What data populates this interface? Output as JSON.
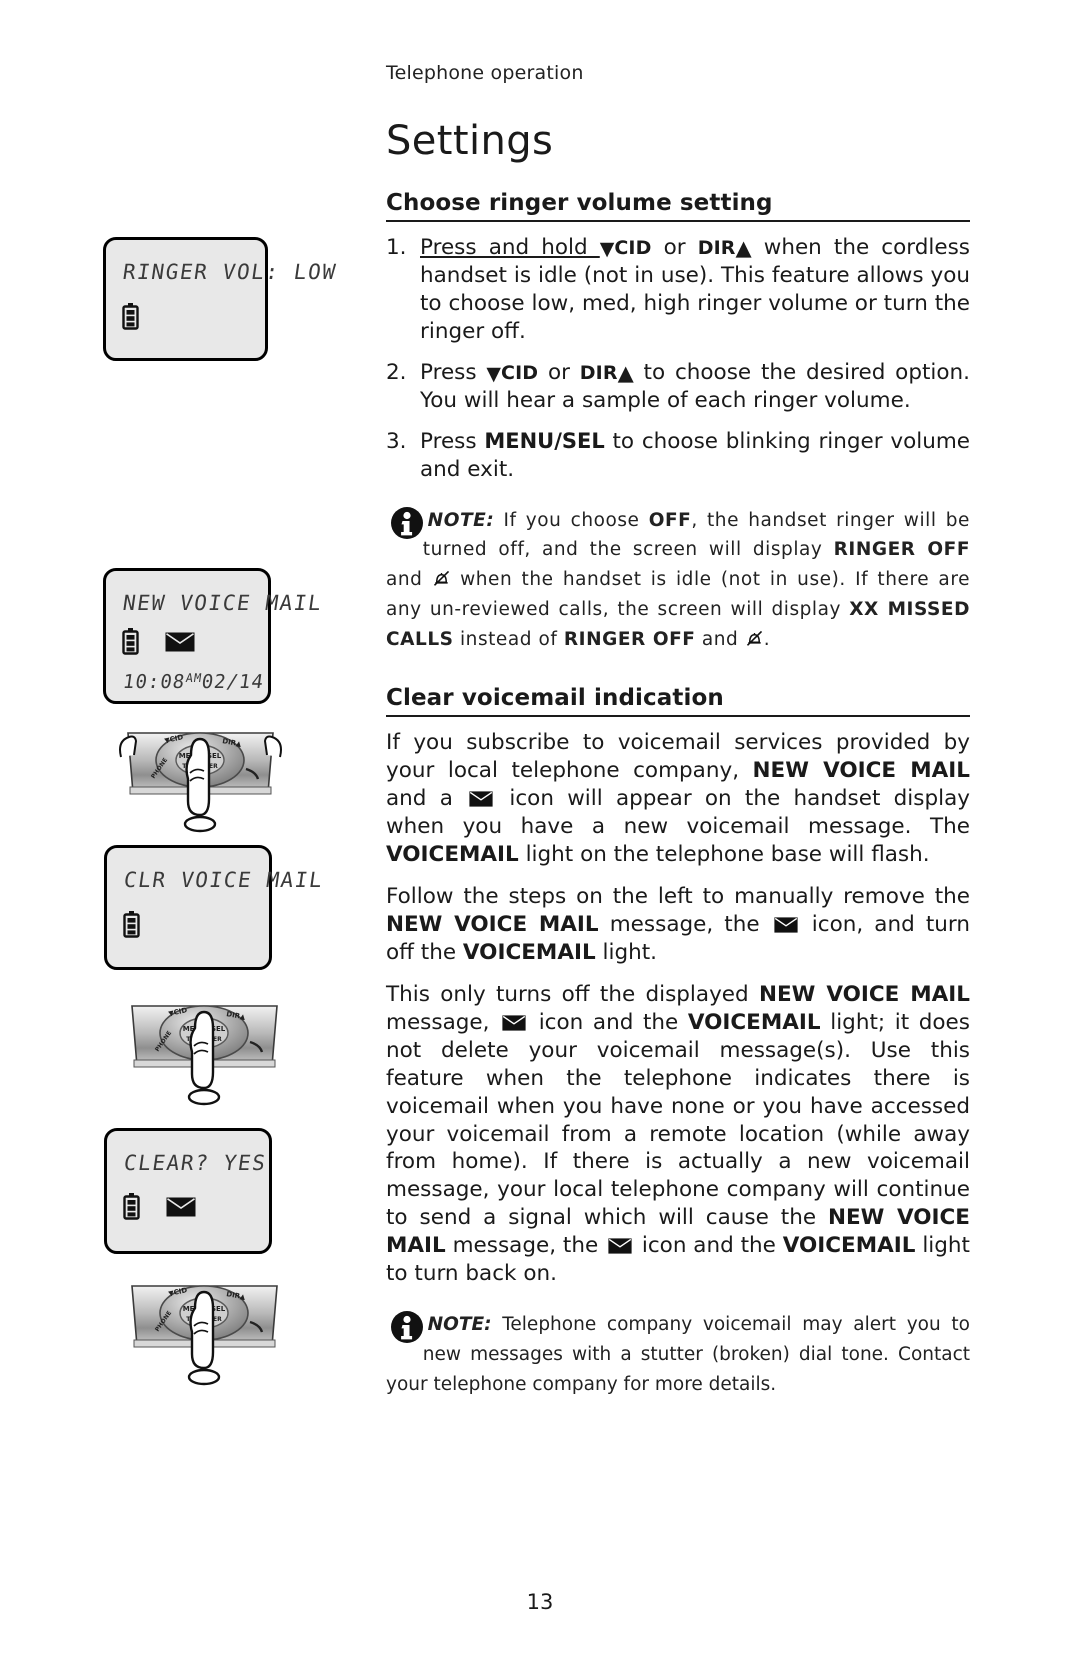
{
  "running_head": "Telephone operation",
  "page_title": "Settings",
  "folio": "13",
  "sections": [
    {
      "id": "ringer-volume",
      "heading": "Choose ringer volume setting",
      "steps": [
        {
          "num": "1.",
          "parts": [
            {
              "t": "Press and hold ",
              "style": "underline"
            },
            {
              "t": "▼",
              "style": "triangle"
            },
            {
              "t": "CID",
              "style": "key"
            },
            {
              "t": " or ",
              "style": "plain"
            },
            {
              "t": "DIR",
              "style": "key"
            },
            {
              "t": " ▲",
              "style": "triangle"
            },
            {
              "t": " when the cordless handset is idle (not in use). This feature allows you to choose low, med, high ringer volume or turn the ringer off.",
              "style": "plain"
            }
          ]
        },
        {
          "num": "2.",
          "parts": [
            {
              "t": "Press ",
              "style": "plain"
            },
            {
              "t": "▼",
              "style": "triangle"
            },
            {
              "t": "CID",
              "style": "key"
            },
            {
              "t": " or ",
              "style": "plain"
            },
            {
              "t": "DIR",
              "style": "key"
            },
            {
              "t": " ▲",
              "style": "triangle"
            },
            {
              "t": " to choose the desired option. You will hear a sample of each ringer volume.",
              "style": "plain"
            }
          ]
        },
        {
          "num": "3.",
          "parts": [
            {
              "t": "Press ",
              "style": "plain"
            },
            {
              "t": "MENU/SEL",
              "style": "key-lg"
            },
            {
              "t": " to choose blinking ringer volume and exit.",
              "style": "plain"
            }
          ]
        }
      ],
      "note": {
        "lead": "NOTE:",
        "parts": [
          {
            "t": " If you choose ",
            "style": "plain"
          },
          {
            "t": "OFF",
            "style": "bold"
          },
          {
            "t": ", the handset ringer will be turned off, and the screen will display ",
            "style": "plain"
          },
          {
            "t": "RINGER OFF",
            "style": "bold"
          },
          {
            "t": " and ",
            "style": "plain"
          },
          {
            "t": "bell-off-icon",
            "style": "icon-bell-off"
          },
          {
            "t": " when the handset is idle (not in use). If there are any un-reviewed calls, the screen will display ",
            "style": "plain"
          },
          {
            "t": "XX MISSED CALLS",
            "style": "bold"
          },
          {
            "t": " instead of ",
            "style": "plain"
          },
          {
            "t": "RINGER OFF",
            "style": "bold"
          },
          {
            "t": " and ",
            "style": "plain"
          },
          {
            "t": "bell-off-icon",
            "style": "icon-bell-off"
          },
          {
            "t": ".",
            "style": "plain"
          }
        ]
      }
    },
    {
      "id": "clear-voicemail",
      "heading": "Clear voicemail indication",
      "paragraphs": [
        [
          {
            "t": "If you subscribe to voicemail services provided by your local telephone company, ",
            "style": "plain"
          },
          {
            "t": "NEW VOICE MAIL",
            "style": "bold"
          },
          {
            "t": " and a ",
            "style": "plain"
          },
          {
            "t": "envelope-icon",
            "style": "icon-envelope"
          },
          {
            "t": " icon will appear on the handset display when you have a new voicemail message. The ",
            "style": "plain"
          },
          {
            "t": "VOICEMAIL",
            "style": "bold"
          },
          {
            "t": " light on the telephone base will flash.",
            "style": "plain"
          }
        ],
        [
          {
            "t": "Follow the steps on the left to manually remove the ",
            "style": "plain"
          },
          {
            "t": "NEW VOICE MAIL",
            "style": "bold"
          },
          {
            "t": " message, the ",
            "style": "plain"
          },
          {
            "t": "envelope-icon",
            "style": "icon-envelope"
          },
          {
            "t": " icon, and turn off the ",
            "style": "plain"
          },
          {
            "t": "VOICEMAIL",
            "style": "bold"
          },
          {
            "t": " light.",
            "style": "plain"
          }
        ],
        [
          {
            "t": "This only turns off the displayed ",
            "style": "plain"
          },
          {
            "t": "NEW VOICE MAIL",
            "style": "bold"
          },
          {
            "t": " message, ",
            "style": "plain"
          },
          {
            "t": "envelope-icon",
            "style": "icon-envelope"
          },
          {
            "t": " icon and the ",
            "style": "plain"
          },
          {
            "t": "VOICEMAIL",
            "style": "bold"
          },
          {
            "t": " light; it does not delete your voicemail message(s). Use this feature when the telephone indicates there is voicemail when you have none or you have accessed your voicemail from a remote location (while away from home). If there is actually a new voicemail message, your local telephone company will continue to send a signal which will cause the ",
            "style": "plain"
          },
          {
            "t": "NEW VOICE MAIL",
            "style": "bold"
          },
          {
            "t": " message, the ",
            "style": "plain"
          },
          {
            "t": "envelope-icon",
            "style": "icon-envelope"
          },
          {
            "t": " icon and the ",
            "style": "plain"
          },
          {
            "t": "VOICEMAIL",
            "style": "bold"
          },
          {
            "t": " light to turn back on.",
            "style": "plain"
          }
        ]
      ],
      "note": {
        "lead": "NOTE:",
        "parts": [
          {
            "t": " Telephone company voicemail may alert you to new messages with a stutter (broken) dial tone. Contact your telephone company for more details.",
            "style": "plain"
          }
        ]
      }
    }
  ],
  "illustrations": {
    "lcd_screens": [
      {
        "id": "lcd-ringer-vol",
        "text": "RINGER VOL: LOW",
        "icons": [
          "battery-icon"
        ],
        "time": null,
        "date": null
      },
      {
        "id": "lcd-new-voice-mail",
        "text": "NEW VOICE MAIL",
        "icons": [
          "battery-icon",
          "envelope-icon"
        ],
        "time": "10:08",
        "ampm": "AM",
        "date": "02/14"
      },
      {
        "id": "lcd-clr-voice-mail",
        "text": "CLR VOICE MAIL",
        "icons": [
          "battery-icon"
        ],
        "time": null,
        "date": null
      },
      {
        "id": "lcd-clear-yes",
        "text": "CLEAR? YES",
        "icons": [
          "battery-icon",
          "envelope-icon"
        ],
        "time": null,
        "date": null
      }
    ],
    "handset_presses": [
      {
        "id": "handset-press-1",
        "keys": [
          "CID",
          "DIR",
          "MENU/SEL",
          "TRANSFER"
        ]
      },
      {
        "id": "handset-press-2",
        "keys": [
          "CID",
          "DIR",
          "MENU/SEL",
          "TRANSFER"
        ]
      },
      {
        "id": "handset-press-3",
        "keys": [
          "CID",
          "DIR",
          "MENU/SEL",
          "TRANSFER"
        ]
      }
    ]
  },
  "colors": {
    "page_bg": "#ffffff",
    "text": "#1a1a1a",
    "lcd_bg": "#e8e8e8",
    "lcd_text": "#3a3a3a",
    "rule": "#1a1a1a"
  }
}
